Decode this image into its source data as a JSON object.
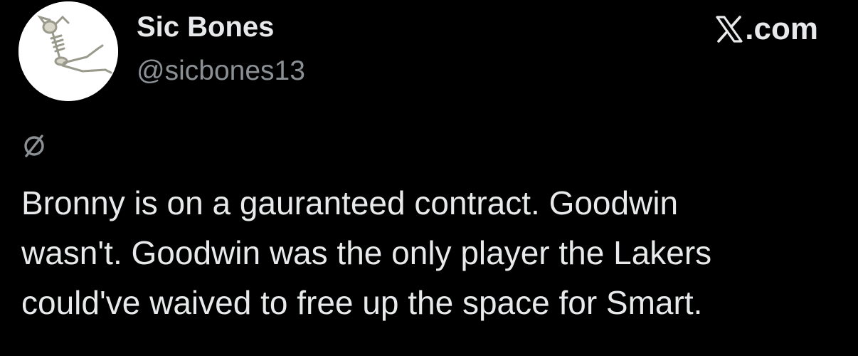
{
  "author": {
    "display_name": "Sic Bones",
    "handle": "@sicbones13",
    "avatar_icon": "skeleton-avatar"
  },
  "brand": {
    "label": ".com",
    "icon": "x-logo-icon"
  },
  "tweet": {
    "status_icon": "empty-set-icon",
    "lines": [
      "Bronny is on a gauranteed contract. Goodwin",
      "wasn't. Goodwin was the only player the Lakers",
      "could've waived to free up the space for Smart."
    ]
  },
  "colors": {
    "background": "#000000",
    "primary_text": "#e7e9ea",
    "secondary_text": "#8b9095"
  }
}
